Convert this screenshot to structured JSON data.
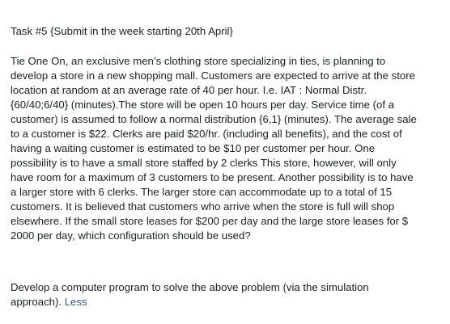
{
  "title": "Task #5 {Submit in the week starting 20th April}",
  "paragraph_lines": [
    "Tie One On, an exclusive men’s clothing store specializing in ties, is planning to",
    "develop a store in a new shopping mall. Customers are expected to arrive at the store",
    "location at random at an average rate of 40 per hour. I.e. IAT : Normal Distr.",
    "{60/40;6/40} (minutes).The store will be open 10 hours per day. Service time (of a",
    "customer) is assumed to follow a normal distribution {6,1} (minutes). The average sale",
    "to a customer is $22. Clerks are paid $20/hr. (including all benefits), and the cost of",
    "having a waiting customer is estimated to be $10 per customer per hour. One",
    "possibility is to have a small store staffed by 2 clerks This store, however, will only",
    "have room for a maximum of 3 customers to be present. Another possibility is to have",
    "a larger store with 6 clerks. The larger store can accommodate up to a total of 15",
    "customers. It is believed that customers who arrive when the store is full will shop",
    "elsewhere. If the small store leases for $200 per day and the large store leases for $",
    "2000 per day, which configuration should be used?"
  ],
  "footer": {
    "line1": "Develop a computer program to solve the above problem (via the simulation",
    "line2": "approach).",
    "less_label": "Less"
  }
}
